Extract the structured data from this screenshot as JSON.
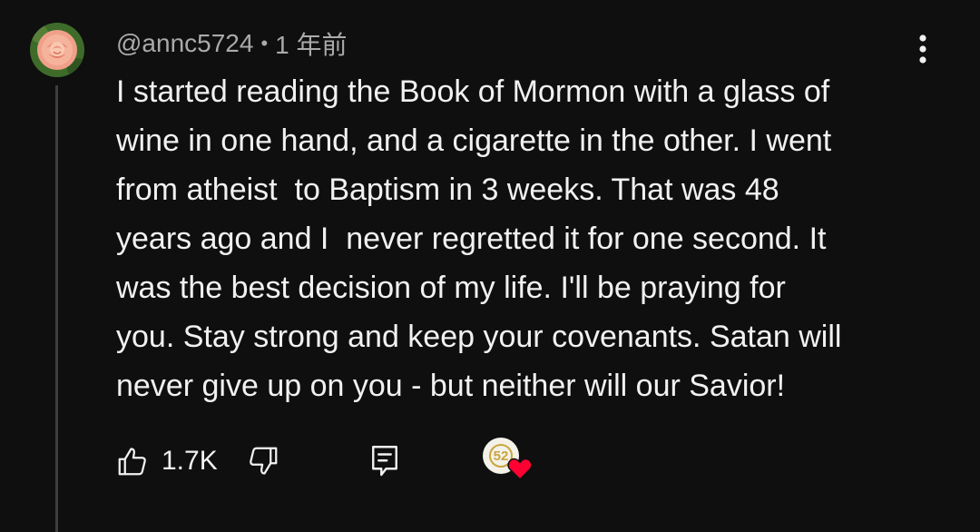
{
  "comment": {
    "handle": "@annc5724",
    "separator": "•",
    "timestamp": "1 年前",
    "text": "I started reading the Book of Mormon with a glass of\nwine in one hand, and a cigarette in the other. I went\nfrom atheist  to Baptism in 3 weeks. That was 48\nyears ago and I  never regretted it for one second. It\nwas the best decision of my life. I'll be praying for\nyou. Stay strong and keep your covenants. Satan will\nnever give up on you - but neither will our Savior!",
    "avatar_icon": "rose-avatar"
  },
  "actions": {
    "like_icon": "thumbs-up-icon",
    "like_count": "1.7K",
    "dislike_icon": "thumbs-down-icon",
    "reply_icon": "reply-icon",
    "creator_heart": {
      "badge_text": "52",
      "heart_color": "#ff0033"
    }
  },
  "menu": {
    "icon": "more-vertical-icon"
  },
  "colors": {
    "background": "#0f0f0f",
    "text": "#f1f1f1",
    "secondary_text": "#aaaaaa",
    "thread_line": "#3d3d3d"
  }
}
